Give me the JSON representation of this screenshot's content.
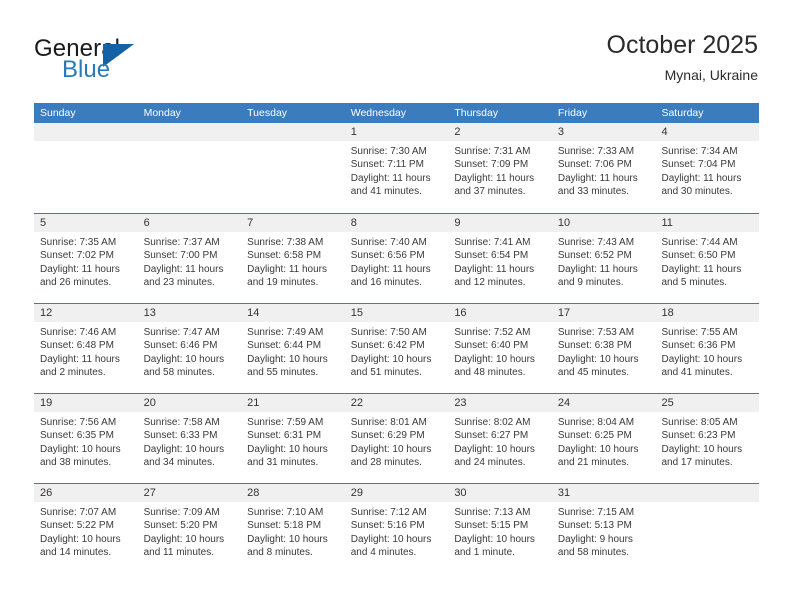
{
  "brand": {
    "word1": "General",
    "word2": "Blue",
    "triangle_color": "#1461a5",
    "blue_color": "#2a7ab9"
  },
  "header": {
    "title": "October 2025",
    "subtitle": "Mynai, Ukraine"
  },
  "theme": {
    "header_blue": "#3a7cbe",
    "date_band": "#f0f0f0",
    "text": "#3a3a3a"
  },
  "weekdays": [
    "Sunday",
    "Monday",
    "Tuesday",
    "Wednesday",
    "Thursday",
    "Friday",
    "Saturday"
  ],
  "weeks": [
    [
      {
        "empty": true
      },
      {
        "empty": true
      },
      {
        "empty": true
      },
      {
        "date": "1",
        "sunrise": "Sunrise: 7:30 AM",
        "sunset": "Sunset: 7:11 PM",
        "daylight": "Daylight: 11 hours and 41 minutes."
      },
      {
        "date": "2",
        "sunrise": "Sunrise: 7:31 AM",
        "sunset": "Sunset: 7:09 PM",
        "daylight": "Daylight: 11 hours and 37 minutes."
      },
      {
        "date": "3",
        "sunrise": "Sunrise: 7:33 AM",
        "sunset": "Sunset: 7:06 PM",
        "daylight": "Daylight: 11 hours and 33 minutes."
      },
      {
        "date": "4",
        "sunrise": "Sunrise: 7:34 AM",
        "sunset": "Sunset: 7:04 PM",
        "daylight": "Daylight: 11 hours and 30 minutes."
      }
    ],
    [
      {
        "date": "5",
        "sunrise": "Sunrise: 7:35 AM",
        "sunset": "Sunset: 7:02 PM",
        "daylight": "Daylight: 11 hours and 26 minutes."
      },
      {
        "date": "6",
        "sunrise": "Sunrise: 7:37 AM",
        "sunset": "Sunset: 7:00 PM",
        "daylight": "Daylight: 11 hours and 23 minutes."
      },
      {
        "date": "7",
        "sunrise": "Sunrise: 7:38 AM",
        "sunset": "Sunset: 6:58 PM",
        "daylight": "Daylight: 11 hours and 19 minutes."
      },
      {
        "date": "8",
        "sunrise": "Sunrise: 7:40 AM",
        "sunset": "Sunset: 6:56 PM",
        "daylight": "Daylight: 11 hours and 16 minutes."
      },
      {
        "date": "9",
        "sunrise": "Sunrise: 7:41 AM",
        "sunset": "Sunset: 6:54 PM",
        "daylight": "Daylight: 11 hours and 12 minutes."
      },
      {
        "date": "10",
        "sunrise": "Sunrise: 7:43 AM",
        "sunset": "Sunset: 6:52 PM",
        "daylight": "Daylight: 11 hours and 9 minutes."
      },
      {
        "date": "11",
        "sunrise": "Sunrise: 7:44 AM",
        "sunset": "Sunset: 6:50 PM",
        "daylight": "Daylight: 11 hours and 5 minutes."
      }
    ],
    [
      {
        "date": "12",
        "sunrise": "Sunrise: 7:46 AM",
        "sunset": "Sunset: 6:48 PM",
        "daylight": "Daylight: 11 hours and 2 minutes."
      },
      {
        "date": "13",
        "sunrise": "Sunrise: 7:47 AM",
        "sunset": "Sunset: 6:46 PM",
        "daylight": "Daylight: 10 hours and 58 minutes."
      },
      {
        "date": "14",
        "sunrise": "Sunrise: 7:49 AM",
        "sunset": "Sunset: 6:44 PM",
        "daylight": "Daylight: 10 hours and 55 minutes."
      },
      {
        "date": "15",
        "sunrise": "Sunrise: 7:50 AM",
        "sunset": "Sunset: 6:42 PM",
        "daylight": "Daylight: 10 hours and 51 minutes."
      },
      {
        "date": "16",
        "sunrise": "Sunrise: 7:52 AM",
        "sunset": "Sunset: 6:40 PM",
        "daylight": "Daylight: 10 hours and 48 minutes."
      },
      {
        "date": "17",
        "sunrise": "Sunrise: 7:53 AM",
        "sunset": "Sunset: 6:38 PM",
        "daylight": "Daylight: 10 hours and 45 minutes."
      },
      {
        "date": "18",
        "sunrise": "Sunrise: 7:55 AM",
        "sunset": "Sunset: 6:36 PM",
        "daylight": "Daylight: 10 hours and 41 minutes."
      }
    ],
    [
      {
        "date": "19",
        "sunrise": "Sunrise: 7:56 AM",
        "sunset": "Sunset: 6:35 PM",
        "daylight": "Daylight: 10 hours and 38 minutes."
      },
      {
        "date": "20",
        "sunrise": "Sunrise: 7:58 AM",
        "sunset": "Sunset: 6:33 PM",
        "daylight": "Daylight: 10 hours and 34 minutes."
      },
      {
        "date": "21",
        "sunrise": "Sunrise: 7:59 AM",
        "sunset": "Sunset: 6:31 PM",
        "daylight": "Daylight: 10 hours and 31 minutes."
      },
      {
        "date": "22",
        "sunrise": "Sunrise: 8:01 AM",
        "sunset": "Sunset: 6:29 PM",
        "daylight": "Daylight: 10 hours and 28 minutes."
      },
      {
        "date": "23",
        "sunrise": "Sunrise: 8:02 AM",
        "sunset": "Sunset: 6:27 PM",
        "daylight": "Daylight: 10 hours and 24 minutes."
      },
      {
        "date": "24",
        "sunrise": "Sunrise: 8:04 AM",
        "sunset": "Sunset: 6:25 PM",
        "daylight": "Daylight: 10 hours and 21 minutes."
      },
      {
        "date": "25",
        "sunrise": "Sunrise: 8:05 AM",
        "sunset": "Sunset: 6:23 PM",
        "daylight": "Daylight: 10 hours and 17 minutes."
      }
    ],
    [
      {
        "date": "26",
        "sunrise": "Sunrise: 7:07 AM",
        "sunset": "Sunset: 5:22 PM",
        "daylight": "Daylight: 10 hours and 14 minutes."
      },
      {
        "date": "27",
        "sunrise": "Sunrise: 7:09 AM",
        "sunset": "Sunset: 5:20 PM",
        "daylight": "Daylight: 10 hours and 11 minutes."
      },
      {
        "date": "28",
        "sunrise": "Sunrise: 7:10 AM",
        "sunset": "Sunset: 5:18 PM",
        "daylight": "Daylight: 10 hours and 8 minutes."
      },
      {
        "date": "29",
        "sunrise": "Sunrise: 7:12 AM",
        "sunset": "Sunset: 5:16 PM",
        "daylight": "Daylight: 10 hours and 4 minutes."
      },
      {
        "date": "30",
        "sunrise": "Sunrise: 7:13 AM",
        "sunset": "Sunset: 5:15 PM",
        "daylight": "Daylight: 10 hours and 1 minute."
      },
      {
        "date": "31",
        "sunrise": "Sunrise: 7:15 AM",
        "sunset": "Sunset: 5:13 PM",
        "daylight": "Daylight: 9 hours and 58 minutes."
      },
      {
        "empty": true
      }
    ]
  ]
}
